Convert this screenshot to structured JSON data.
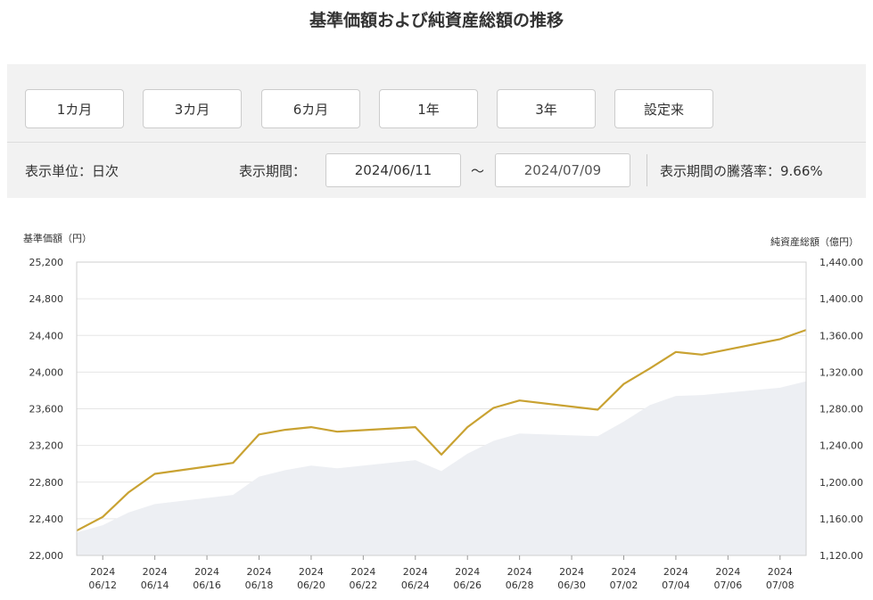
{
  "title": "基準価額および純資産総額の推移",
  "period_buttons": [
    "1カ月",
    "3カ月",
    "6カ月",
    "1年",
    "3年",
    "設定来"
  ],
  "controls": {
    "unit_label": "表示単位：日次",
    "period_label": "表示期間：",
    "from_date": "2024/06/11",
    "tilde": "～",
    "to_date": "2024/07/09",
    "change_rate_label": "表示期間の騰落率：9.66%"
  },
  "colors": {
    "line": "#c9a232",
    "area": "#edeff3",
    "grid": "#e6e6e6",
    "axis": "#999"
  },
  "chart_data": {
    "type": "line",
    "left_axis_label": "基準価額（円）",
    "right_axis_label": "純資産総額（億円）",
    "y_left_range": [
      22000,
      25200
    ],
    "y_right_range": [
      1120,
      1440
    ],
    "y_left_ticks": [
      "25,200",
      "24,800",
      "24,400",
      "24,000",
      "23,600",
      "23,200",
      "22,800",
      "22,400",
      "22,000"
    ],
    "y_right_ticks": [
      "1,440.00",
      "1,400.00",
      "1,360.00",
      "1,320.00",
      "1,280.00",
      "1,240.00",
      "1,200.00",
      "1,160.00",
      "1,120.00"
    ],
    "x_ticks": [
      {
        "year": "2024",
        "md": "06/12"
      },
      {
        "year": "2024",
        "md": "06/14"
      },
      {
        "year": "2024",
        "md": "06/16"
      },
      {
        "year": "2024",
        "md": "06/18"
      },
      {
        "year": "2024",
        "md": "06/20"
      },
      {
        "year": "2024",
        "md": "06/22"
      },
      {
        "year": "2024",
        "md": "06/24"
      },
      {
        "year": "2024",
        "md": "06/26"
      },
      {
        "year": "2024",
        "md": "06/28"
      },
      {
        "year": "2024",
        "md": "06/30"
      },
      {
        "year": "2024",
        "md": "07/02"
      },
      {
        "year": "2024",
        "md": "07/04"
      },
      {
        "year": "2024",
        "md": "07/06"
      },
      {
        "year": "2024",
        "md": "07/08"
      }
    ],
    "x_range": [
      "2024-06-11",
      "2024-07-09"
    ],
    "series": [
      {
        "kind": "line",
        "points": [
          [
            "2024-06-11",
            22270
          ],
          [
            "2024-06-12",
            22420
          ],
          [
            "2024-06-13",
            22690
          ],
          [
            "2024-06-14",
            22890
          ],
          [
            "2024-06-17",
            23010
          ],
          [
            "2024-06-18",
            23320
          ],
          [
            "2024-06-19",
            23370
          ],
          [
            "2024-06-20",
            23400
          ],
          [
            "2024-06-21",
            23350
          ],
          [
            "2024-06-24",
            23400
          ],
          [
            "2024-06-25",
            23100
          ],
          [
            "2024-06-26",
            23400
          ],
          [
            "2024-06-27",
            23610
          ],
          [
            "2024-06-28",
            23690
          ],
          [
            "2024-07-01",
            23590
          ],
          [
            "2024-07-02",
            23870
          ],
          [
            "2024-07-03",
            24040
          ],
          [
            "2024-07-04",
            24220
          ],
          [
            "2024-07-05",
            24190
          ],
          [
            "2024-07-08",
            24360
          ],
          [
            "2024-07-09",
            24460
          ]
        ]
      },
      {
        "kind": "area",
        "points": [
          [
            "2024-06-11",
            1145
          ],
          [
            "2024-06-12",
            1153
          ],
          [
            "2024-06-13",
            1167
          ],
          [
            "2024-06-14",
            1176
          ],
          [
            "2024-06-17",
            1186
          ],
          [
            "2024-06-18",
            1206
          ],
          [
            "2024-06-19",
            1213
          ],
          [
            "2024-06-20",
            1218
          ],
          [
            "2024-06-21",
            1215
          ],
          [
            "2024-06-24",
            1224
          ],
          [
            "2024-06-25",
            1212
          ],
          [
            "2024-06-26",
            1231
          ],
          [
            "2024-06-27",
            1245
          ],
          [
            "2024-06-28",
            1253
          ],
          [
            "2024-07-01",
            1250
          ],
          [
            "2024-07-02",
            1266
          ],
          [
            "2024-07-03",
            1284
          ],
          [
            "2024-07-04",
            1294
          ],
          [
            "2024-07-05",
            1295
          ],
          [
            "2024-07-08",
            1303
          ],
          [
            "2024-07-09",
            1310
          ]
        ]
      }
    ]
  }
}
